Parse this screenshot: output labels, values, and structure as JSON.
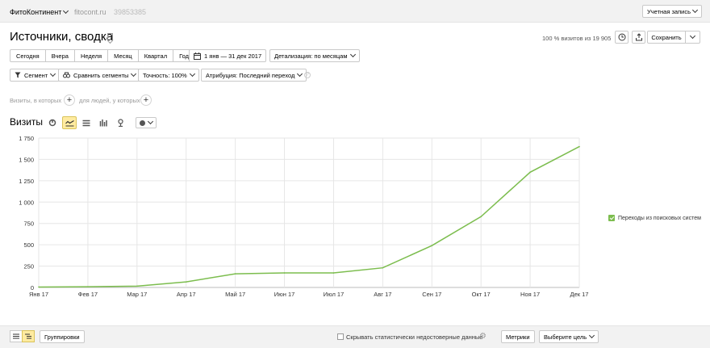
{
  "topbar": {
    "counter_name": "ФитоКонтинент",
    "site": "fitocont.ru",
    "counter_id": "39853385",
    "account_label": "Учетная запись"
  },
  "header": {
    "title": "Источники, сводка",
    "visits_share": "100 % визитов из 19 905",
    "save_label": "Сохранить"
  },
  "periods": [
    "Сегодня",
    "Вчера",
    "Неделя",
    "Месяц",
    "Квартал",
    "Год"
  ],
  "date_range": "1 янв — 31 дек 2017",
  "detail": "Детализация: по месяцам",
  "segment_label": "Сегмент",
  "compare_label": "Сравнить сегменты",
  "accuracy_label": "Точность: 100%",
  "attribution_label": "Атрибуция: Последний переход",
  "filter": {
    "visits_text": "Визиты, в которых",
    "people_text": "для людей, у которых"
  },
  "visits_label": "Визиты",
  "legend_label": "Переходы из поисковых систем",
  "colors": {
    "line": "#7cbd4e",
    "accent": "#ffeba0"
  },
  "bottom": {
    "groupings_label": "Группировки",
    "hide_label": "Скрывать статистически недостоверные данные",
    "metrics_label": "Метрики",
    "goal_label": "Выберите цель"
  },
  "chart_data": {
    "type": "line",
    "categories": [
      "Янв 17",
      "Фев 17",
      "Мар 17",
      "Апр 17",
      "Май 17",
      "Июн 17",
      "Июл 17",
      "Авг 17",
      "Сен 17",
      "Окт 17",
      "Ноя 17",
      "Дек 17"
    ],
    "series": [
      {
        "name": "Переходы из поисковых систем",
        "values": [
          5,
          8,
          15,
          65,
          160,
          170,
          170,
          230,
          490,
          830,
          1350,
          1650
        ]
      }
    ],
    "y_ticks": [
      0,
      250,
      500,
      750,
      1000,
      1250,
      1500,
      1750
    ],
    "ylim": [
      0,
      1750
    ],
    "grid": true,
    "legend": "right"
  }
}
